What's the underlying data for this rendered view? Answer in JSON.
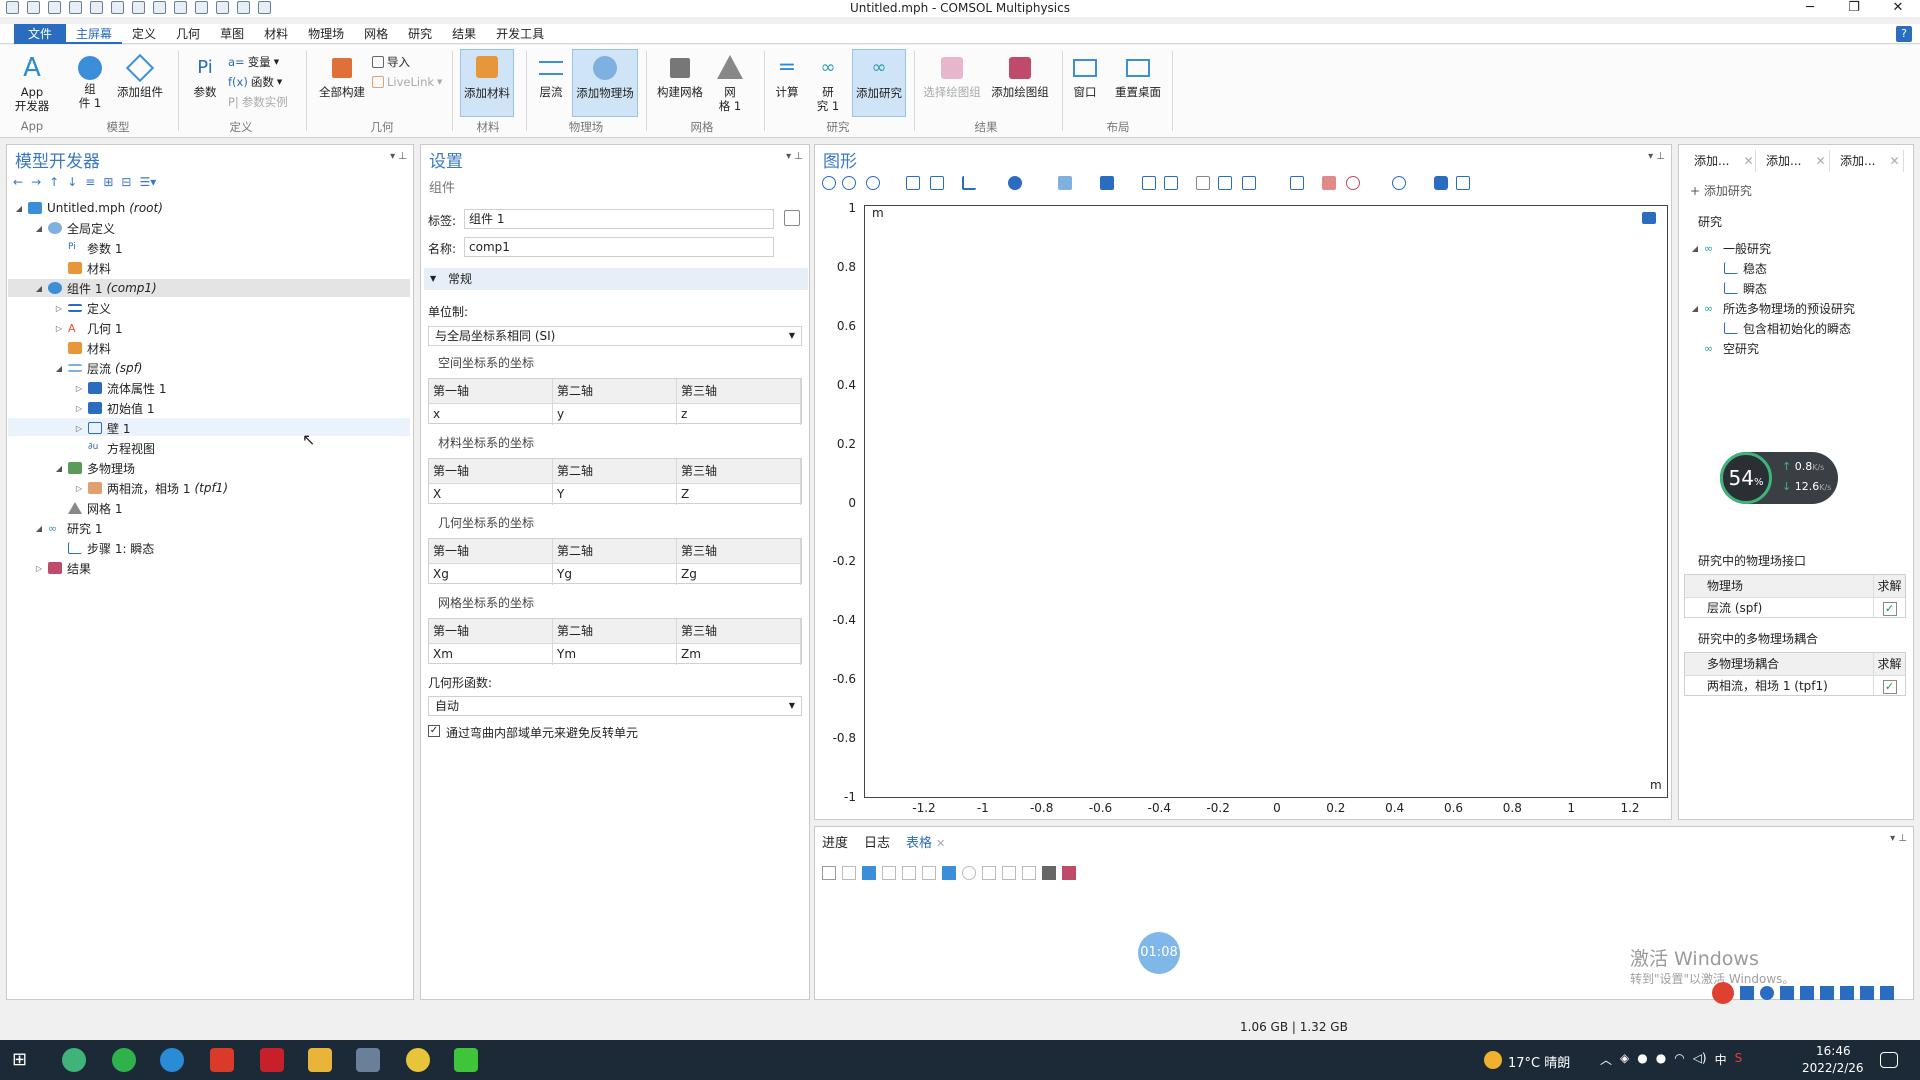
{
  "window": {
    "title": "Untitled.mph - COMSOL Multiphysics",
    "minimize": "─",
    "maximize": "❐",
    "close": "✕"
  },
  "menu": {
    "file": "文件",
    "tabs": [
      "主屏幕",
      "定义",
      "几何",
      "草图",
      "材料",
      "物理场",
      "网格",
      "研究",
      "结果",
      "开发工具"
    ],
    "help": "?"
  },
  "ribbon": {
    "app_builder": "App\n开发器",
    "component": "组\n件 1",
    "add_component": "添加组件",
    "parameters": "参数",
    "variables": "变量",
    "functions": "函数",
    "param_case": "参数实例",
    "build_all": "全部构建",
    "import": "导入",
    "livelink": "LiveLink",
    "add_material": "添加材料",
    "laminar": "层流",
    "add_physics": "添加物理场",
    "build_mesh": "构建网格",
    "mesh1": "网\n格 1",
    "compute": "计算",
    "study1": "研\n究 1",
    "add_study": "添加研究",
    "select_plot_group": "选择绘图组",
    "add_plot_group": "添加绘图组",
    "windows": "窗口",
    "reset_desktop": "重置桌面",
    "groups": {
      "app": "App",
      "model": "模型",
      "definitions": "定义",
      "geometry": "几何",
      "materials": "材料",
      "physics": "物理场",
      "mesh": "网格",
      "study": "研究",
      "results": "结果",
      "layout": "布局"
    }
  },
  "model_builder": {
    "title": "模型开发器",
    "tree": [
      {
        "label": "Untitled.mph",
        "tag": "(root)"
      },
      {
        "label": "全局定义"
      },
      {
        "label": "参数 1"
      },
      {
        "label": "材料"
      },
      {
        "label": "组件 1",
        "tag": "(comp1)"
      },
      {
        "label": "定义"
      },
      {
        "label": "几何 1"
      },
      {
        "label": "材料"
      },
      {
        "label": "层流",
        "tag": "(spf)"
      },
      {
        "label": "流体属性 1"
      },
      {
        "label": "初始值 1"
      },
      {
        "label": "壁 1"
      },
      {
        "label": "方程视图"
      },
      {
        "label": "多物理场"
      },
      {
        "label": "两相流，相场 1",
        "tag": "(tpf1)"
      },
      {
        "label": "网格 1"
      },
      {
        "label": "研究 1"
      },
      {
        "label": "步骤 1: 瞬态"
      },
      {
        "label": "结果"
      }
    ]
  },
  "settings": {
    "title": "设置",
    "subtitle": "组件",
    "label_label": "标签:",
    "label_value": "组件 1",
    "name_label": "名称:",
    "name_value": "comp1",
    "section_general": "常规",
    "unit_system_label": "单位制:",
    "unit_system_value": "与全局坐标系相同 (SI)",
    "coords": [
      {
        "header": "空间坐标系的坐标",
        "axes": [
          "第一轴",
          "第二轴",
          "第三轴"
        ],
        "values": [
          "x",
          "y",
          "z"
        ]
      },
      {
        "header": "材料坐标系的坐标",
        "axes": [
          "第一轴",
          "第二轴",
          "第三轴"
        ],
        "values": [
          "X",
          "Y",
          "Z"
        ]
      },
      {
        "header": "几何坐标系的坐标",
        "axes": [
          "第一轴",
          "第二轴",
          "第三轴"
        ],
        "values": [
          "Xg",
          "Yg",
          "Zg"
        ]
      },
      {
        "header": "网格坐标系的坐标",
        "axes": [
          "第一轴",
          "第二轴",
          "第三轴"
        ],
        "values": [
          "Xm",
          "Ym",
          "Zm"
        ]
      }
    ],
    "geom_shape_label": "几何形函数:",
    "geom_shape_value": "自动",
    "curved_interior_label": "通过弯曲内部域单元来避免反转单元",
    "curved_interior_checked": "✓"
  },
  "graphics": {
    "title": "图形",
    "unit_y": "m",
    "unit_x": "m",
    "y_ticks": [
      "1",
      "0.8",
      "0.6",
      "0.4",
      "0.2",
      "0",
      "-0.2",
      "-0.4",
      "-0.6",
      "-0.8",
      "-1"
    ],
    "x_ticks": [
      "-1.2",
      "-1",
      "-0.8",
      "-0.6",
      "-0.4",
      "-0.2",
      "0",
      "0.2",
      "0.4",
      "0.6",
      "0.8",
      "1",
      "1.2"
    ]
  },
  "add_study": {
    "tabs": [
      "添加...",
      "添加...",
      "添加..."
    ],
    "add_study_btn": "添加研究",
    "studies_header": "研究",
    "tree": [
      {
        "label": "一般研究"
      },
      {
        "label": "稳态"
      },
      {
        "label": "瞬态"
      },
      {
        "label": "所选多物理场的预设研究"
      },
      {
        "label": "包含相初始化的瞬态"
      },
      {
        "label": "空研究"
      }
    ],
    "physics_header": "研究中的物理场接口",
    "physics_col": "物理场",
    "solve_col": "求解",
    "physics_row": "层流 (spf)",
    "multi_header": "研究中的多物理场耦合",
    "multi_col": "多物理场耦合",
    "multi_row": "两相流，相场 1 (tpf1)",
    "check": "✓"
  },
  "net_widget": {
    "percent": "54",
    "pct_sign": "%",
    "up": "0.8",
    "down": "12.6",
    "unit": "K/s"
  },
  "bottom": {
    "tabs": [
      "进度",
      "日志",
      "表格"
    ],
    "timer": "01:08",
    "watermark1": "激活 Windows",
    "watermark2": "转到\"设置\"以激活 Windows。"
  },
  "status": {
    "memory": "1.06 GB | 1.32 GB"
  },
  "taskbar": {
    "weather": "17°C 晴朗",
    "time": "16:46",
    "date": "2022/2/26",
    "ime": "中"
  }
}
